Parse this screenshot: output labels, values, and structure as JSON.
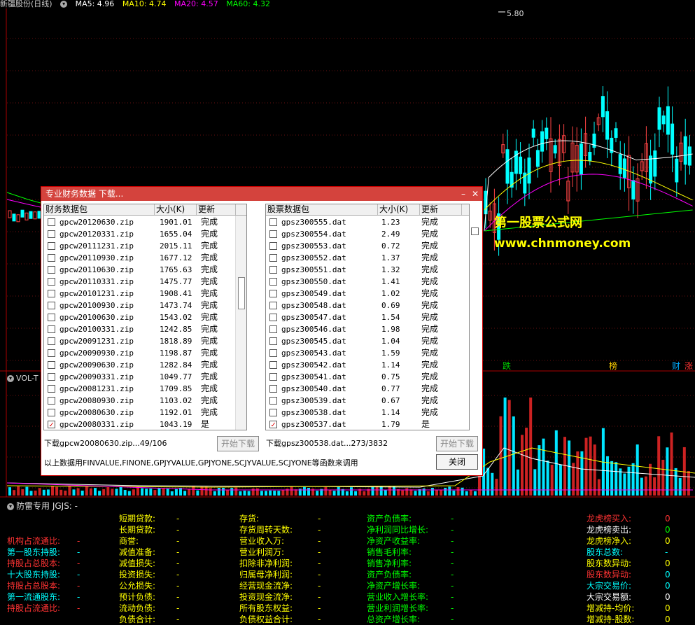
{
  "header": {
    "stock": "新疆股份(日线)",
    "ma5": "MA5: 4.96",
    "ma10": "MA10: 4.74",
    "ma20": "MA20: 4.57",
    "ma60": "MA60: 4.32",
    "colors": {
      "ma5": "#ffffff",
      "ma10": "#ffff00",
      "ma20": "#ff00ff",
      "ma60": "#00ff00"
    }
  },
  "price_high_label": "5.80",
  "signals": [
    {
      "text": "跌",
      "color": "#00cc00"
    },
    {
      "text": "榜",
      "color": "#ffd000"
    },
    {
      "text": "财",
      "color": "#00aaff"
    },
    {
      "text": "涨",
      "color": "#ff3333"
    }
  ],
  "vol_title": "VOL-T",
  "fin_title": "防雷专用  JGJS: -",
  "watermark": {
    "line1": "第一股票公式网",
    "line2": "www.chnmoney.com"
  },
  "fin_columns": [
    {
      "rows": [
        {
          "label": "",
          "value": ""
        },
        {
          "label": "",
          "value": ""
        },
        {
          "label": "机构占流通比:",
          "value": "-",
          "color": "#ff3333"
        },
        {
          "label": "第一股东持股:",
          "value": "-",
          "color": "#00ffff"
        },
        {
          "label": "持股占总股本:",
          "value": "-",
          "color": "#ff3333"
        },
        {
          "label": "十大股东持股:",
          "value": "-",
          "color": "#00ffff"
        },
        {
          "label": "持股占总股本:",
          "value": "-",
          "color": "#ff3333"
        },
        {
          "label": "第一流通股东:",
          "value": "-",
          "color": "#00ffff"
        },
        {
          "label": "持股占流通比:",
          "value": "-",
          "color": "#ff3333"
        }
      ]
    },
    {
      "rows": [
        {
          "label": "短期贷款:",
          "value": "-",
          "color": "#ffff00"
        },
        {
          "label": "长期贷款:",
          "value": "-",
          "color": "#ffff00"
        },
        {
          "label": "商誉:",
          "value": "-",
          "color": "#ffff00"
        },
        {
          "label": "减值准备:",
          "value": "-",
          "color": "#ffff00"
        },
        {
          "label": "减值损失:",
          "value": "-",
          "color": "#ffff00"
        },
        {
          "label": "投资损失:",
          "value": "-",
          "color": "#ffff00"
        },
        {
          "label": "公允损失:",
          "value": "-",
          "color": "#ffff00"
        },
        {
          "label": "预计负债:",
          "value": "-",
          "color": "#ffff00"
        },
        {
          "label": "流动负债:",
          "value": "-",
          "color": "#ffff00"
        },
        {
          "label": "负债合计:",
          "value": "-",
          "color": "#ffff00"
        }
      ]
    },
    {
      "rows": [
        {
          "label": "存货:",
          "value": "-",
          "color": "#ffff00"
        },
        {
          "label": "存货周转天数:",
          "value": "-",
          "color": "#ffff00"
        },
        {
          "label": "营业收入万:",
          "value": "-",
          "color": "#ffff00"
        },
        {
          "label": "营业利润万:",
          "value": "-",
          "color": "#ffff00"
        },
        {
          "label": "扣除非净利润:",
          "value": "-",
          "color": "#ffff00"
        },
        {
          "label": "归属母净利润:",
          "value": "-",
          "color": "#ffff00"
        },
        {
          "label": "经营现金流净:",
          "value": "-",
          "color": "#ffff00"
        },
        {
          "label": "投资现金流净:",
          "value": "-",
          "color": "#ffff00"
        },
        {
          "label": "所有股东权益:",
          "value": "-",
          "color": "#ffff00"
        },
        {
          "label": "负债权益合计:",
          "value": "-",
          "color": "#ffff00"
        }
      ]
    },
    {
      "rows": [
        {
          "label": "资产负债率:",
          "value": "-",
          "color": "#00ff00"
        },
        {
          "label": "净利润同比增长:",
          "value": "-",
          "color": "#00ff00"
        },
        {
          "label": "净资产收益率:",
          "value": "-",
          "color": "#00ff00"
        },
        {
          "label": "销售毛利率:",
          "value": "-",
          "color": "#00ff00"
        },
        {
          "label": "销售净利率:",
          "value": "-",
          "color": "#00ff00"
        },
        {
          "label": "资产负债率:",
          "value": "-",
          "color": "#00ff00"
        },
        {
          "label": "净资产增长率:",
          "value": "-",
          "color": "#00ff00"
        },
        {
          "label": "营业收入增长率:",
          "value": "-",
          "color": "#00ff00"
        },
        {
          "label": "营业利润增长率:",
          "value": "-",
          "color": "#00ff00"
        },
        {
          "label": "总资产增长率:",
          "value": "-",
          "color": "#00ff00"
        }
      ]
    },
    {
      "rows": [
        {
          "label": "龙虎榜买入:",
          "value": "0",
          "color": "#ff3333",
          "vcolor": "#ff3333"
        },
        {
          "label": "龙虎榜卖出:",
          "value": "0",
          "color": "#ffffff",
          "vcolor": "#00ff00"
        },
        {
          "label": "龙虎榜净入:",
          "value": "0",
          "color": "#ffff00",
          "vcolor": "#ffff00"
        },
        {
          "label": "股东总数:",
          "value": "-",
          "color": "#00ffff",
          "vcolor": "#00ffff"
        },
        {
          "label": "股东数异动:",
          "value": "0",
          "color": "#ffff00",
          "vcolor": "#ffff00"
        },
        {
          "label": "股东数异动:",
          "value": "0",
          "color": "#ff3333",
          "vcolor": "#00ffff"
        },
        {
          "label": "大宗交易价:",
          "value": "0",
          "color": "#00ffff",
          "vcolor": "#00ffff"
        },
        {
          "label": "大宗交易额:",
          "value": "0",
          "color": "#ffffff",
          "vcolor": "#ffffff"
        },
        {
          "label": "增减持-均价:",
          "value": "0",
          "color": "#ffff00",
          "vcolor": "#ffff00"
        },
        {
          "label": "增减持-股数:",
          "value": "0",
          "color": "#ffff00",
          "vcolor": "#ffff00"
        }
      ]
    }
  ],
  "dialog": {
    "title": "专业财务数据 下载...",
    "left": {
      "headers": [
        "财务数据包",
        "大小(K)",
        "更新"
      ],
      "rows": [
        {
          "name": "gpcw20120630.zip",
          "size": "1901.01",
          "status": "完成",
          "checked": false
        },
        {
          "name": "gpcw20120331.zip",
          "size": "1655.04",
          "status": "完成",
          "checked": false
        },
        {
          "name": "gpcw20111231.zip",
          "size": "2015.11",
          "status": "完成",
          "checked": false
        },
        {
          "name": "gpcw20110930.zip",
          "size": "1677.12",
          "status": "完成",
          "checked": false
        },
        {
          "name": "gpcw20110630.zip",
          "size": "1765.63",
          "status": "完成",
          "checked": false
        },
        {
          "name": "gpcw20110331.zip",
          "size": "1475.77",
          "status": "完成",
          "checked": false
        },
        {
          "name": "gpcw20101231.zip",
          "size": "1908.41",
          "status": "完成",
          "checked": false
        },
        {
          "name": "gpcw20100930.zip",
          "size": "1473.74",
          "status": "完成",
          "checked": false
        },
        {
          "name": "gpcw20100630.zip",
          "size": "1543.02",
          "status": "完成",
          "checked": false
        },
        {
          "name": "gpcw20100331.zip",
          "size": "1242.85",
          "status": "完成",
          "checked": false
        },
        {
          "name": "gpcw20091231.zip",
          "size": "1818.89",
          "status": "完成",
          "checked": false
        },
        {
          "name": "gpcw20090930.zip",
          "size": "1198.87",
          "status": "完成",
          "checked": false
        },
        {
          "name": "gpcw20090630.zip",
          "size": "1282.84",
          "status": "完成",
          "checked": false
        },
        {
          "name": "gpcw20090331.zip",
          "size": "1049.77",
          "status": "完成",
          "checked": false
        },
        {
          "name": "gpcw20081231.zip",
          "size": "1709.85",
          "status": "完成",
          "checked": false
        },
        {
          "name": "gpcw20080930.zip",
          "size": "1103.02",
          "status": "完成",
          "checked": false
        },
        {
          "name": "gpcw20080630.zip",
          "size": "1192.01",
          "status": "完成",
          "checked": false
        },
        {
          "name": "gpcw20080331.zip",
          "size": "1043.19",
          "status": "是",
          "checked": true
        }
      ]
    },
    "right": {
      "headers": [
        "股票数据包",
        "大小(K)",
        "更新"
      ],
      "rows": [
        {
          "name": "gpsz300555.dat",
          "size": "1.23",
          "status": "完成",
          "checked": false
        },
        {
          "name": "gpsz300554.dat",
          "size": "2.49",
          "status": "完成",
          "checked": false
        },
        {
          "name": "gpsz300553.dat",
          "size": "0.72",
          "status": "完成",
          "checked": false
        },
        {
          "name": "gpsz300552.dat",
          "size": "1.37",
          "status": "完成",
          "checked": false
        },
        {
          "name": "gpsz300551.dat",
          "size": "1.32",
          "status": "完成",
          "checked": false
        },
        {
          "name": "gpsz300550.dat",
          "size": "1.41",
          "status": "完成",
          "checked": false
        },
        {
          "name": "gpsz300549.dat",
          "size": "1.02",
          "status": "完成",
          "checked": false
        },
        {
          "name": "gpsz300548.dat",
          "size": "0.69",
          "status": "完成",
          "checked": false
        },
        {
          "name": "gpsz300547.dat",
          "size": "1.54",
          "status": "完成",
          "checked": false
        },
        {
          "name": "gpsz300546.dat",
          "size": "1.98",
          "status": "完成",
          "checked": false
        },
        {
          "name": "gpsz300545.dat",
          "size": "1.04",
          "status": "完成",
          "checked": false
        },
        {
          "name": "gpsz300543.dat",
          "size": "1.59",
          "status": "完成",
          "checked": false
        },
        {
          "name": "gpsz300542.dat",
          "size": "1.14",
          "status": "完成",
          "checked": false
        },
        {
          "name": "gpsz300541.dat",
          "size": "0.75",
          "status": "完成",
          "checked": false
        },
        {
          "name": "gpsz300540.dat",
          "size": "0.77",
          "status": "完成",
          "checked": false
        },
        {
          "name": "gpsz300539.dat",
          "size": "0.67",
          "status": "完成",
          "checked": false
        },
        {
          "name": "gpsz300538.dat",
          "size": "1.14",
          "status": "完成",
          "checked": false
        },
        {
          "name": "gpsz300537.dat",
          "size": "1.79",
          "status": "是",
          "checked": true
        }
      ]
    },
    "left_status": "下载gpcw20080630.zip...49/106",
    "right_status": "下载gpsz300538.dat...273/3832",
    "start_label": "开始下载",
    "note": "以上数据用FINVALUE,FINONE,GPJYVALUE,GPJYONE,SCJYVALUE,SCJYONE等函数来调用",
    "close_label": "关闭"
  }
}
